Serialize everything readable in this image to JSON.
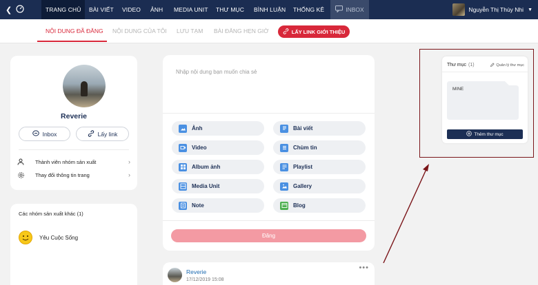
{
  "nav": {
    "items": [
      "TRANG CHỦ",
      "BÀI VIẾT",
      "VIDEO",
      "ẢNH",
      "MEDIA UNIT",
      "THƯ MỤC",
      "BÌNH LUẬN",
      "THỐNG KÊ"
    ],
    "inbox": "INBOX",
    "user_name": "Nguyễn Thị Thùy Nhi"
  },
  "subtabs": {
    "items": [
      "NỘI DUNG ĐÃ ĐĂNG",
      "NỘI DUNG CỦA TÔI",
      "LƯU TẠM",
      "BÀI ĐĂNG HẸN GIỜ"
    ],
    "share_link": "LẤY LINK GIỚI THIỆU"
  },
  "profile": {
    "name": "Reverie",
    "inbox_label": "Inbox",
    "getlink_label": "Lấy link",
    "members_label": "Thành viên nhóm sản xuất",
    "settings_label": "Thay đổi thông tin trang"
  },
  "groups": {
    "title": "Các nhóm sản xuất khác (1)",
    "items": [
      "Yêu Cuộc Sống"
    ]
  },
  "composer": {
    "placeholder": "Nhập nội dung bạn muốn chia sẻ",
    "options": [
      "Ảnh",
      "Bài viết",
      "Video",
      "Chùm tin",
      "Album ảnh",
      "Playlist",
      "Media Unit",
      "Gallery",
      "Note",
      "Blog"
    ],
    "post_label": "Đăng"
  },
  "feed": {
    "author": "Reverie",
    "time": "17/12/2019 15:08",
    "more": "•••"
  },
  "folders": {
    "title": "Thư mục",
    "count": "(1)",
    "manage": "Quản lý thư mục",
    "folder_name": "MINE",
    "add_label": "Thêm thư mục"
  },
  "colors": {
    "nav_bg": "#1b2d52",
    "accent_red": "#d8283a",
    "post_button": "#f39aa3",
    "annotation": "#7a1418",
    "icon_blue": "#4a90e2",
    "icon_green": "#4caf50"
  }
}
